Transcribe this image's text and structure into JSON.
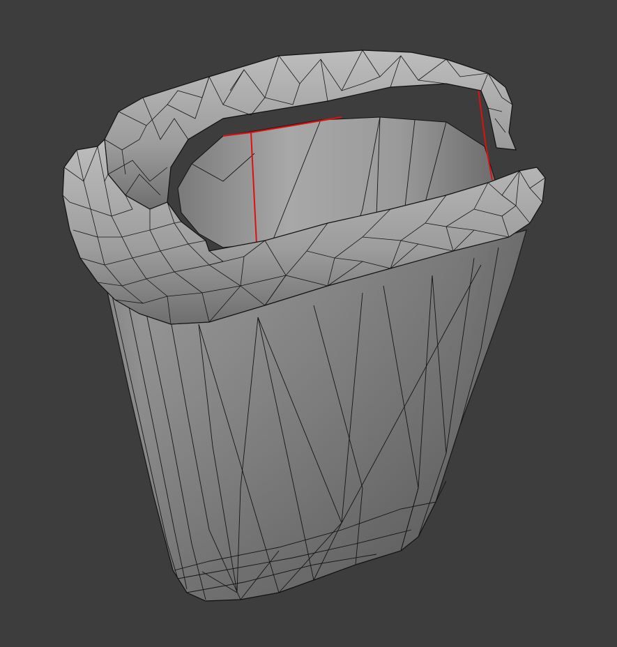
{
  "viewport": {
    "background_color": "#3d3d3d"
  },
  "model": {
    "object": "wireframe-cup",
    "shading": "solid",
    "overlay": "wireframe",
    "colors": {
      "surface_light": "#b8b8b8",
      "surface_mid": "#8c8c8c",
      "surface_dark": "#555555",
      "wire": "#111111",
      "seam": "#e01010"
    }
  }
}
